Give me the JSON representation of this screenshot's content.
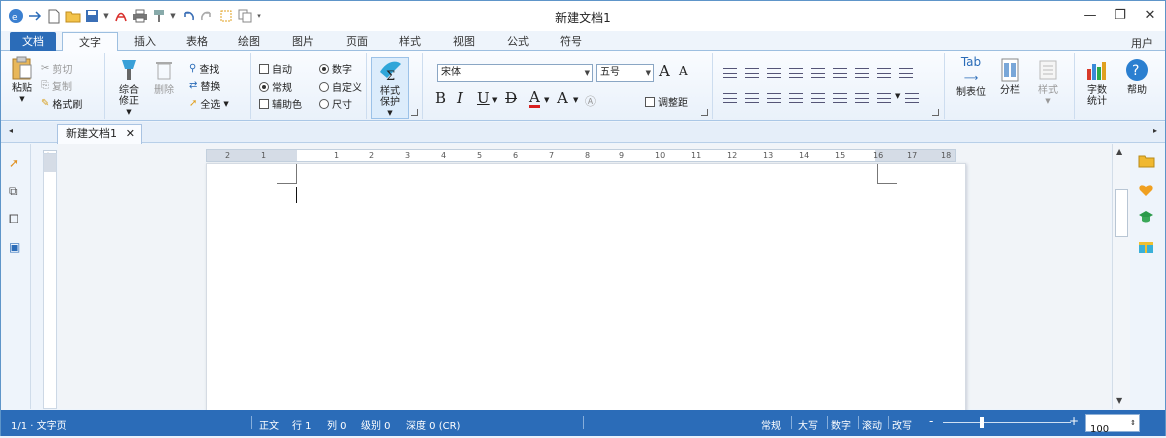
{
  "titlebar": {
    "title": "新建文档1",
    "window_controls": [
      "minimize",
      "maximize",
      "close"
    ]
  },
  "quick_access_icons": [
    "app-logo-icon",
    "new-icon",
    "open-icon",
    "save-icon",
    "pdf-icon",
    "print-icon",
    "format-painter-icon",
    "undo-icon",
    "redo-icon",
    "crop-icon",
    "copy-icon"
  ],
  "tabs": [
    {
      "label": "文档",
      "kind": "file"
    },
    {
      "label": "文字",
      "kind": "active"
    },
    {
      "label": "插入"
    },
    {
      "label": "表格"
    },
    {
      "label": "绘图"
    },
    {
      "label": "图片"
    },
    {
      "label": "页面"
    },
    {
      "label": "样式"
    },
    {
      "label": "视图"
    },
    {
      "label": "公式"
    },
    {
      "label": "符号"
    }
  ],
  "user_label": "用户",
  "ribbon": {
    "paste": "粘贴",
    "cut": "剪切",
    "copy": "复制",
    "format_painter": "格式刷",
    "comprehensive_edit": [
      "综合",
      "修正"
    ],
    "delete": "删除",
    "find": "查找",
    "replace": "替换",
    "select": "全选",
    "auto": "自动",
    "regular": "常规",
    "assist_color": "辅助色",
    "number": "数字",
    "custom": "自定义",
    "size": "尺寸",
    "style_protect": [
      "样式",
      "保护"
    ],
    "font_name": "宋体",
    "font_size": "五号",
    "grow_font": "A",
    "shrink_font": "A",
    "bold": "B",
    "italic": "I",
    "underline": "U",
    "strike": "D",
    "font_color": "A",
    "clear_format": "A",
    "paragraph_spacing": "调整距",
    "tab_stop_top": "Tab",
    "tab_stop": "制表位",
    "columns": "分栏",
    "styles": "样式",
    "word_count": [
      "字数",
      "统计"
    ],
    "help": "帮助"
  },
  "doc_tab": {
    "label": "新建文档1"
  },
  "ruler_numbers": [
    "2",
    "1",
    "1",
    "2",
    "3",
    "4",
    "5",
    "6",
    "7",
    "8",
    "9",
    "10",
    "11",
    "12",
    "13",
    "14",
    "15",
    "16",
    "17",
    "18"
  ],
  "status": {
    "page": "1/1 · 文字页",
    "line_info": "正文",
    "row": "行 1",
    "col": "列 0",
    "level": "级别 0",
    "depth": "深度 0 (CR)",
    "mode": "常规",
    "caps": "大写",
    "num": "数字",
    "scroll": "滚动",
    "overwrite": "改写",
    "zoom": "100"
  },
  "colors": {
    "accent": "#2b6cb8",
    "ribbon_bg": "#fafcff"
  }
}
